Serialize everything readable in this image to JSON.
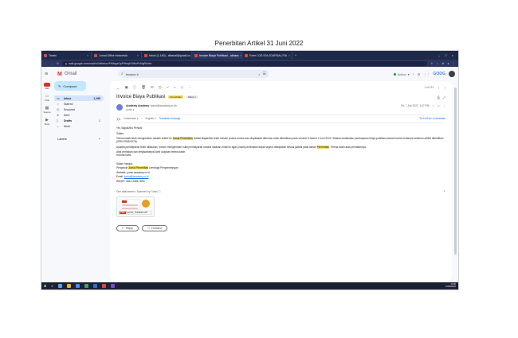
{
  "caption": "Penerbitan Artikel 31 Juni 2022",
  "browser": {
    "tabs": [
      {
        "label": "Tanzin",
        "active": false
      },
      {
        "label": "Jurnal Office Indonesia",
        "active": false
      },
      {
        "label": "Inbox (1,190) - albanaf@gmail.co",
        "active": false
      },
      {
        "label": "Invoice Biaya Publikasi - albana",
        "active": true
      },
      {
        "label": "Form LOG IOA JOURNAL FIA",
        "active": false
      }
    ],
    "new_tab": "+",
    "url": "mail.google.com/mail/u/0/#inbox/FMfcgzGpFWsqNVWxPvNgRVnbr",
    "window_controls": [
      "–",
      "□",
      "×"
    ]
  },
  "gmail": {
    "app_name": "Gmail",
    "search_text": "Invoice b",
    "status": "Active",
    "apps_label": "GOOG",
    "rail": [
      "Mail",
      "Chat",
      "Spaces",
      "Meet"
    ],
    "compose": "Compose",
    "nav": [
      {
        "label": "Inbox",
        "count": "1,190",
        "icon": "inbox-icon",
        "selected": true
      },
      {
        "label": "Starred",
        "count": "",
        "icon": "star-icon",
        "selected": false
      },
      {
        "label": "Snoozed",
        "count": "",
        "icon": "clock-icon",
        "selected": false
      },
      {
        "label": "Sent",
        "count": "",
        "icon": "send-icon",
        "selected": false
      },
      {
        "label": "Drafts",
        "count": "1",
        "icon": "draft-icon",
        "selected": false
      },
      {
        "label": "More",
        "count": "",
        "icon": "chevron-down-icon",
        "selected": false
      }
    ],
    "labels_heading": "Labels",
    "labels_add": "+"
  },
  "email": {
    "pager": "1 of 121",
    "subject": "Invoice Biaya Publikasi",
    "tag1": "Penerbitan",
    "tag2": "Inbox ×",
    "sender_name": "Academy Academy",
    "sender_email": "<jurnal@academy.or.id>",
    "to_line": "to me ▾",
    "date": "Fri, 7 Jun 2022, 1:47 PM",
    "translate_from": "Indonesian ▾",
    "translate_to": "English ▾",
    "translate_link": "Translate message",
    "translate_off": "Turn off for: Indonesian",
    "greeting": "Yth. Bapak/Ibu Penulis",
    "salam": "Salam",
    "p1_before": "Terima kasih telah mengirimkan naskah artikel ke ",
    "p1_hl": "Jurnal Penerbitan",
    "p1_after": ". Artikel Bapak/Ibu telah melalui proses review dan dinyatakan diterima untuk diterbitkan pada Volume 6 Nomor 2 Juni 2022. Silakan melakukan pembayaran biaya publikasi sesuai invoice terlampir sebelum artikel diterbitkan (ISSN 2598-0076).",
    "p2_before": "Apabila pembayaran telah dilakukan, mohon mengirimkan bukti pembayaran melalui balasan email ini agar proses penerbitan dapat segera dilanjutkan sesuai jadwal pada laman ",
    "p2_hl": "Penerbitan",
    "p2_after": ". Terima kasih atas perhatiannya.",
    "p3": "Atas perhatian dan kerjasamanya kami ucapkan terima kasih.",
    "p3b": "Hormat kami,",
    "sig1": "Salam hangat,",
    "sig2_before": "Pengelola ",
    "sig2_hl": "Jurnal Penerbitan",
    "sig2_after": " Lembaga Pengembangan",
    "sig3": "Website: jurnal.academy.or.id",
    "sig4_label": "Email: ",
    "sig4_link": "jurnal@academy.or.id",
    "sig5": "WA/HP: 0812-3456-7890",
    "attach_heading": "One attachment • Scanned by Gmail ⓘ",
    "attach_file": "Invoice_Publikasi.pdf",
    "attach_ext": "PDF",
    "reply": "Reply",
    "forward": "Forward"
  },
  "taskbar": {
    "time": "13:06",
    "date": "07/06/2022"
  }
}
